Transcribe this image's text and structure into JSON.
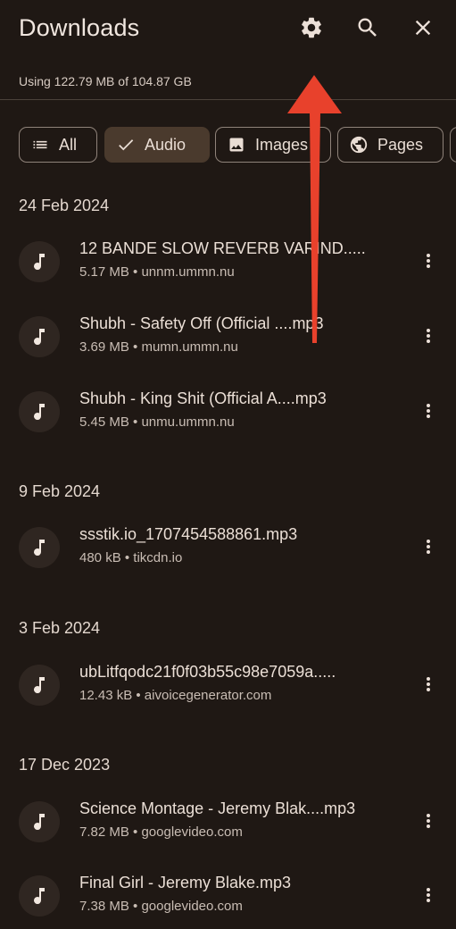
{
  "header": {
    "title": "Downloads",
    "usage": "Using 122.79 MB of 104.87 GB"
  },
  "icons": {
    "settings": "gear-icon",
    "search": "search-icon",
    "close": "close-icon"
  },
  "filters": [
    {
      "label": "All",
      "icon": "list-icon",
      "selected": false
    },
    {
      "label": "Audio",
      "icon": "check-icon",
      "selected": true
    },
    {
      "label": "Images",
      "icon": "image-icon",
      "selected": false
    },
    {
      "label": "Pages",
      "icon": "globe-icon",
      "selected": false
    }
  ],
  "sections": [
    {
      "date": "24 Feb 2024",
      "items": [
        {
          "name": "12 BANDE SLOW  REVERB  VARIND.....",
          "size": "5.17 MB",
          "source": "unnm.ummn.nu",
          "meta": "5.17 MB • unnm.ummn.nu"
        },
        {
          "name": "Shubh - Safety Off (Official ....mp3",
          "size": "3.69 MB",
          "source": "mumn.ummn.nu",
          "meta": "3.69 MB • mumn.ummn.nu"
        },
        {
          "name": "Shubh - King Shit (Official A....mp3",
          "size": "5.45 MB",
          "source": "unmu.ummn.nu",
          "meta": "5.45 MB • unmu.ummn.nu"
        }
      ]
    },
    {
      "date": "9 Feb 2024",
      "items": [
        {
          "name": "ssstik.io_1707454588861.mp3",
          "size": "480 kB",
          "source": "tikcdn.io",
          "meta": "480 kB • tikcdn.io"
        }
      ]
    },
    {
      "date": "3 Feb 2024",
      "items": [
        {
          "name": "ubLitfqodc21f0f03b55c98e7059a.....",
          "size": "12.43 kB",
          "source": "aivoicegenerator.com",
          "meta": "12.43 kB • aivoicegenerator.com"
        }
      ]
    },
    {
      "date": "17 Dec 2023",
      "items": [
        {
          "name": "Science Montage - Jeremy Blak....mp3",
          "size": "7.82 MB",
          "source": "googlevideo.com",
          "meta": "7.82 MB • googlevideo.com"
        },
        {
          "name": "Final Girl - Jeremy Blake.mp3",
          "size": "7.38 MB",
          "source": "googlevideo.com",
          "meta": "7.38 MB • googlevideo.com"
        }
      ]
    }
  ],
  "colors": {
    "background": "#1f1814",
    "selected_chip": "#4a3a2d",
    "annotation_arrow": "#e8412c"
  }
}
